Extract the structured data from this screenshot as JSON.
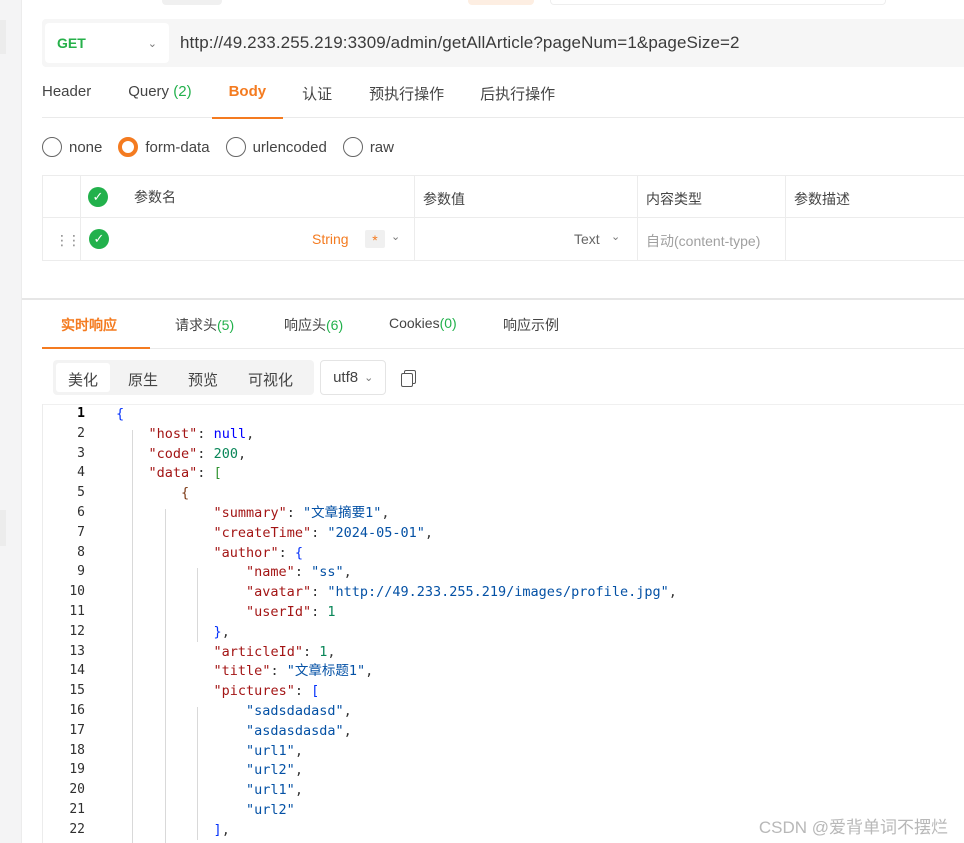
{
  "request": {
    "method": "GET",
    "url": "http://49.233.255.219:3309/admin/getAllArticle?pageNum=1&pageSize=2"
  },
  "request_tabs": [
    {
      "label": "Header",
      "count": ""
    },
    {
      "label": "Query",
      "count": "(2)"
    },
    {
      "label": "Body",
      "count": ""
    },
    {
      "label": "认证",
      "count": ""
    },
    {
      "label": "预执行操作",
      "count": ""
    },
    {
      "label": "后执行操作",
      "count": ""
    }
  ],
  "active_request_tab": "Body",
  "body_types": [
    "none",
    "form-data",
    "urlencoded",
    "raw"
  ],
  "selected_body_type": "form-data",
  "param_table": {
    "headers": [
      "参数名",
      "参数值",
      "内容类型",
      "参数描述"
    ],
    "row": {
      "type": "String",
      "required_mark": "*",
      "value_type": "Text",
      "content_type_placeholder": "自动(content-type)"
    }
  },
  "response_tabs": [
    {
      "label": "实时响应",
      "count": ""
    },
    {
      "label": "请求头",
      "count": "(5)"
    },
    {
      "label": "响应头",
      "count": "(6)"
    },
    {
      "label": "Cookies",
      "count": "(0)"
    },
    {
      "label": "响应示例",
      "count": ""
    }
  ],
  "active_response_tab": "实时响应",
  "view_modes": [
    "美化",
    "原生",
    "预览",
    "可视化"
  ],
  "active_view_mode": "美化",
  "encoding": "utf8",
  "response_lines": [
    "{",
    "    \"host\": null,",
    "    \"code\": 200,",
    "    \"data\": [",
    "        {",
    "            \"summary\": \"文章摘要1\",",
    "            \"createTime\": \"2024-05-01\",",
    "            \"author\": {",
    "                \"name\": \"ss\",",
    "                \"avatar\": \"http://49.233.255.219/images/profile.jpg\",",
    "                \"userId\": 1",
    "            },",
    "            \"articleId\": 1,",
    "            \"title\": \"文章标题1\",",
    "            \"pictures\": [",
    "                \"sadsdadasd\",",
    "                \"asdasdasda\",",
    "                \"url1\",",
    "                \"url2\",",
    "                \"url1\",",
    "                \"url2\"",
    "            ],"
  ],
  "watermark": "CSDN @爱背单词不摆烂",
  "colors": {
    "accent": "#f47b20",
    "success": "#22b14c",
    "json_key": "#a31515",
    "json_string": "#0451a5",
    "json_number": "#098658"
  }
}
